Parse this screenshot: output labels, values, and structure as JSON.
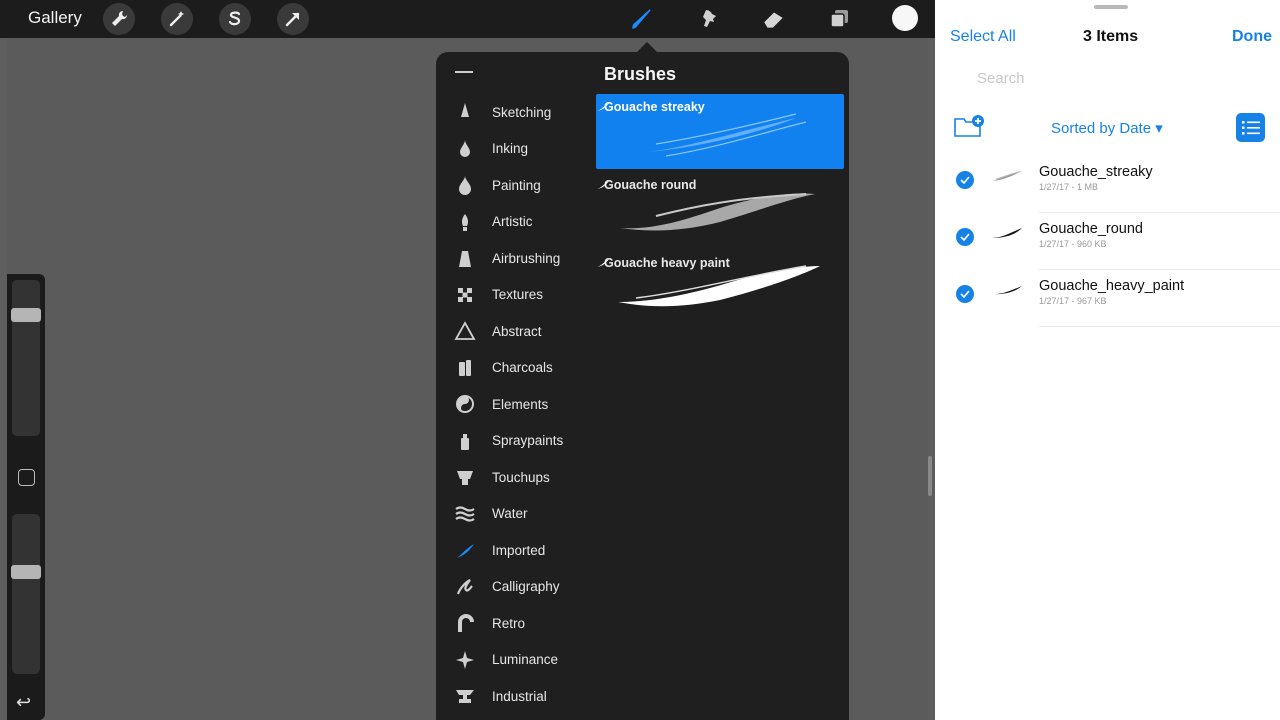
{
  "toolbar": {
    "gallery_label": "Gallery",
    "left_tools": [
      "wrench-icon",
      "magic-wand-icon",
      "selection-s-icon",
      "transform-arrow-icon"
    ],
    "right_tools": [
      "brush-icon",
      "smudge-icon",
      "eraser-icon",
      "layers-icon"
    ],
    "active_tool": "brush-icon",
    "current_color": "#f7f7f7"
  },
  "sidebar": {
    "brush_size_level": 0.2,
    "opacity_level": 0.65,
    "undo_icon": "undo-icon"
  },
  "brush_library": {
    "title": "Brushes",
    "categories": [
      {
        "label": "Sketching",
        "icon": "pencil-tip-icon"
      },
      {
        "label": "Inking",
        "icon": "ink-drop-icon"
      },
      {
        "label": "Painting",
        "icon": "paint-drop-icon"
      },
      {
        "label": "Artistic",
        "icon": "brush-tip-icon"
      },
      {
        "label": "Airbrushing",
        "icon": "airbrush-icon"
      },
      {
        "label": "Textures",
        "icon": "checker-icon"
      },
      {
        "label": "Abstract",
        "icon": "triangle-icon"
      },
      {
        "label": "Charcoals",
        "icon": "charcoal-icon"
      },
      {
        "label": "Elements",
        "icon": "yin-yang-icon"
      },
      {
        "label": "Spraypaints",
        "icon": "spray-can-icon"
      },
      {
        "label": "Touchups",
        "icon": "touchup-icon"
      },
      {
        "label": "Water",
        "icon": "waves-icon"
      },
      {
        "label": "Imported",
        "icon": "stroke-icon",
        "selected": true
      },
      {
        "label": "Calligraphy",
        "icon": "calligraphy-icon"
      },
      {
        "label": "Retro",
        "icon": "retro-icon"
      },
      {
        "label": "Luminance",
        "icon": "sparkle-icon"
      },
      {
        "label": "Industrial",
        "icon": "anvil-icon"
      }
    ],
    "brushes": [
      {
        "name": "Gouache streaky",
        "selected": true
      },
      {
        "name": "Gouache round",
        "selected": false
      },
      {
        "name": "Gouache heavy paint",
        "selected": false
      }
    ],
    "accent_color": "#1181ef"
  },
  "files": {
    "select_all_label": "Select All",
    "title": "3 Items",
    "done_label": "Done",
    "search_placeholder": "Search",
    "sort_label": "Sorted by Date",
    "new_folder_icon": "new-folder-icon",
    "list_view_icon": "list-view-icon",
    "items": [
      {
        "name": "Gouache_streaky",
        "meta": "1/27/17 - 1 MB",
        "checked": true
      },
      {
        "name": "Gouache_round",
        "meta": "1/27/17 - 960 KB",
        "checked": true
      },
      {
        "name": "Gouache_heavy_paint",
        "meta": "1/27/17 - 967 KB",
        "checked": true
      }
    ],
    "accent_color": "#1782e6"
  }
}
